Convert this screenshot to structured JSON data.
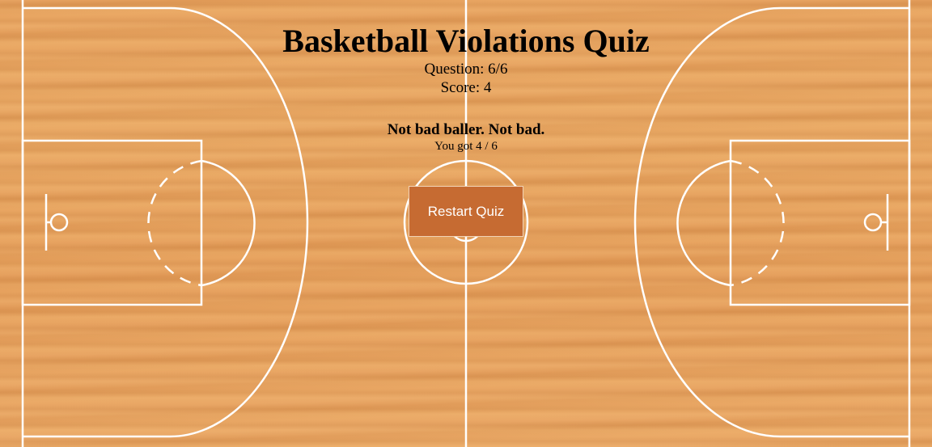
{
  "quiz": {
    "title": "Basketball Violations Quiz",
    "question_label": "Question:",
    "question_progress": "6/6",
    "score_label": "Score:",
    "score_value": "4",
    "result_message": "Not bad baller. Not bad.",
    "result_detail": "You got 4 / 6",
    "restart_label": "Restart Quiz"
  },
  "colors": {
    "court_wood": "#e8a462",
    "court_line": "#ffffff",
    "button_bg": "#c66b32",
    "button_text": "#ffffff",
    "text": "#000000"
  }
}
